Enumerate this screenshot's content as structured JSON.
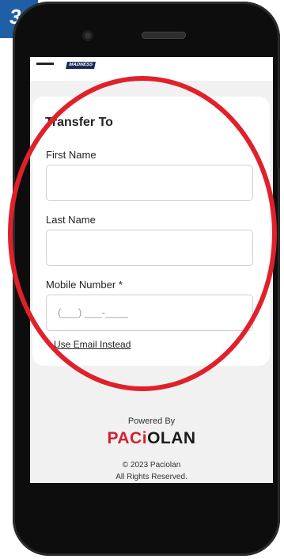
{
  "step": {
    "number": "3"
  },
  "app": {
    "brand": "MADNESS"
  },
  "form": {
    "title": "Transfer To",
    "first_name_label": "First Name",
    "first_name_value": "",
    "last_name_label": "Last Name",
    "last_name_value": "",
    "mobile_label": "Mobile Number *",
    "mobile_placeholder": "(___) ___-____",
    "email_link": "Use Email Instead"
  },
  "footer": {
    "powered_by": "Powered By",
    "logo_part1": "PACi",
    "logo_part2": "OLAN",
    "copyright": "© 2023 Paciolan",
    "rights": "All Rights Reserved."
  },
  "colors": {
    "badge": "#1f5fa6",
    "annotation": "#e0202a",
    "logo_red": "#d6202e"
  },
  "icons": [
    "menu-icon",
    "camera-icon"
  ]
}
